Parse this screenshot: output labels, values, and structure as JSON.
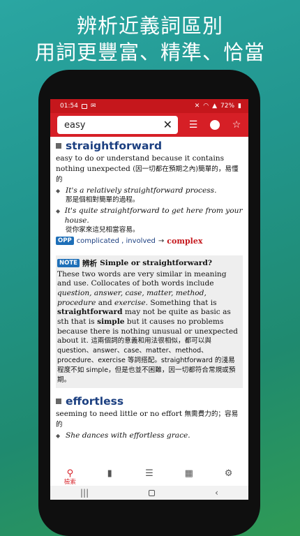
{
  "promo": {
    "line1": "辨析近義詞區別",
    "line2": "用詞更豐富、精準、恰當"
  },
  "status_bar": {
    "time": "01:54",
    "battery": "72%"
  },
  "toolbar": {
    "search_value": "easy",
    "clear_icon": "close-icon",
    "list_icon": "list-icon",
    "circle_icon": "circle-icon",
    "star_icon": "star-icon"
  },
  "entry1": {
    "headword": "straightforward",
    "definition_en": "easy to do or understand because it contains nothing unexpected",
    "definition_zh": "(因一切都在預期之內)簡單的，易懂的",
    "examples": [
      {
        "en": "It's a relatively straightforward process.",
        "zh": "那是個相對簡單的過程。"
      },
      {
        "en": "It's quite straightforward to get here from your house.",
        "zh": "從你家來這兒相當容易。"
      }
    ],
    "opp_badge": "OPP",
    "opp_words": "complicated , involved",
    "opp_arrow": "→",
    "opp_link": "complex"
  },
  "note": {
    "badge": "NOTE",
    "title_zh": "辨析",
    "title_en": "Simple or straightforward?"
  },
  "entry2": {
    "headword": "effortless",
    "definition_en": "seeming to need little or no effort",
    "definition_zh": "無需費力的；容易的",
    "examples": [
      {
        "en": "She dances with effortless grace."
      }
    ]
  },
  "bottom_nav": {
    "items": [
      {
        "label": "檢索",
        "icon": "search-icon",
        "active": true
      },
      {
        "label": "",
        "icon": "bookmark-icon"
      },
      {
        "label": "",
        "icon": "list-icon"
      },
      {
        "label": "",
        "icon": "grid-icon"
      },
      {
        "label": "",
        "icon": "gear-icon"
      }
    ]
  },
  "colors": {
    "brand_red": "#d61f26",
    "headword_blue": "#1b3f80",
    "badge_blue": "#1e6fb8"
  }
}
